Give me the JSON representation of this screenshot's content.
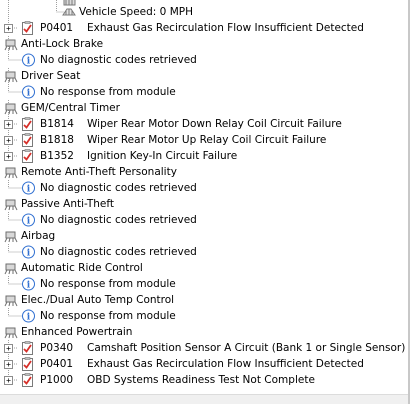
{
  "tree": {
    "vehicle_speed": "Vehicle Speed: 0 MPH",
    "row_egr_top": {
      "code": "P0401",
      "description": "Exhaust Gas Recirculation Flow Insufficient Detected"
    },
    "anti_lock_brake": {
      "label": "Anti-Lock Brake",
      "status": "No diagnostic codes retrieved"
    },
    "driver_seat": {
      "label": "Driver Seat",
      "status": "No response from module"
    },
    "gem_timer": {
      "label": "GEM/Central Timer",
      "codes": [
        {
          "code": "B1814",
          "description": "Wiper Rear Motor Down Relay Coil Circuit Failure"
        },
        {
          "code": "B1818",
          "description": "Wiper Rear Motor Up Relay Coil Circuit Failure"
        },
        {
          "code": "B1352",
          "description": "Ignition Key-In Circuit Failure"
        }
      ]
    },
    "remote_anti_theft": {
      "label": "Remote Anti-Theft Personality",
      "status": "No diagnostic codes retrieved"
    },
    "passive_anti_theft": {
      "label": "Passive Anti-Theft",
      "status": "No diagnostic codes retrieved"
    },
    "airbag": {
      "label": "Airbag",
      "status": "No diagnostic codes retrieved"
    },
    "auto_ride_control": {
      "label": "Automatic Ride Control",
      "status": "No response from module"
    },
    "dual_auto_temp": {
      "label": "Elec./Dual Auto Temp Control",
      "status": "No response from module"
    },
    "enhanced_powertrain": {
      "label": "Enhanced Powertrain",
      "codes": [
        {
          "code": "P0340",
          "description": "Camshaft Position Sensor A Circuit (Bank 1 or Single Sensor)"
        },
        {
          "code": "P0401",
          "description": "Exhaust Gas Recirculation Flow Insufficient Detected"
        },
        {
          "code": "P1000",
          "description": "OBD Systems Readiness Test Not Complete"
        }
      ]
    }
  },
  "icons": {
    "module": "module-chip-icon",
    "code": "clipboard-check-icon",
    "info": "info-icon",
    "sensor": "sensor-icon"
  },
  "colors": {
    "tree_line": "#a0a0a0",
    "info_blue": "#2f6fd1",
    "code_red": "#d6302a"
  }
}
